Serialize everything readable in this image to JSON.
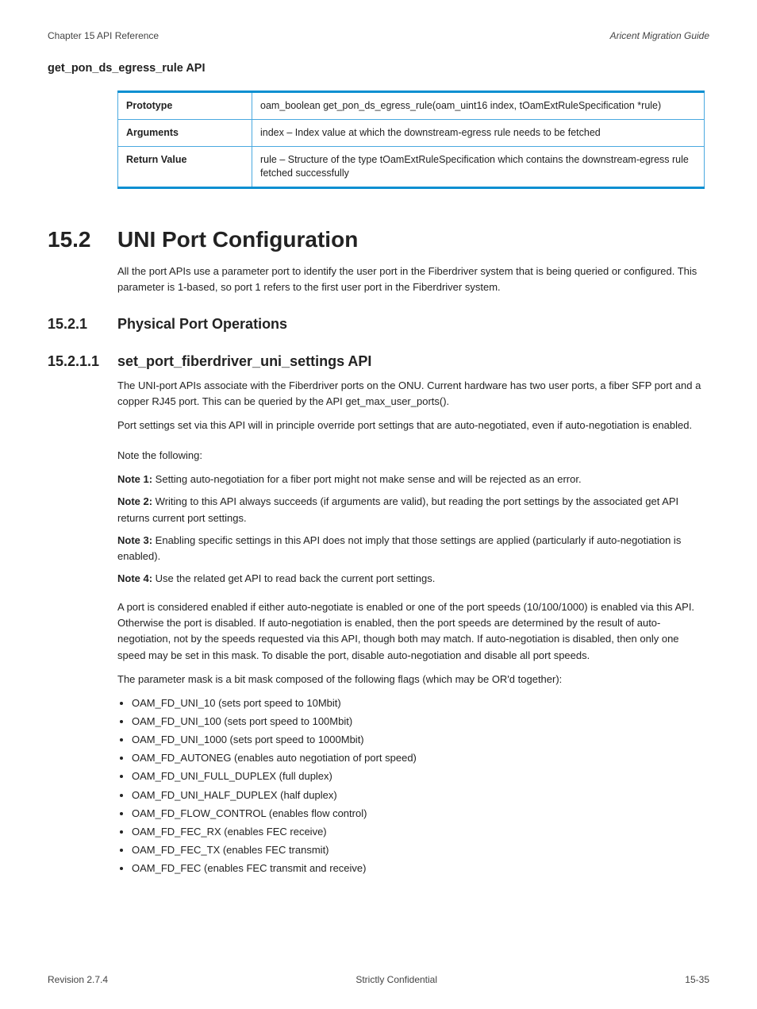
{
  "header": {
    "chapter": "Chapter 15 API Reference",
    "guide": "Aricent Migration Guide"
  },
  "doctitle": "get_pon_ds_egress_rule API",
  "table": [
    {
      "k": "Prototype",
      "v": "oam_boolean get_pon_ds_egress_rule(oam_uint16 index, tOamExtRuleSpecification *rule)"
    },
    {
      "k": "Arguments",
      "v": "index – Index value at which the downstream-egress rule needs to be fetched"
    },
    {
      "k": "Return Value",
      "v": "rule – Structure of the type tOamExtRuleSpecification which contains the downstream-egress rule fetched successfully"
    }
  ],
  "sec": {
    "n": "15.2",
    "t": "UNI Port Configuration"
  },
  "p1": "All the port APIs use a parameter port to identify the user port in the Fiberdriver system that is being queried or configured. This parameter is 1-based, so port 1 refers to the first user port in the Fiberdriver system.",
  "sub_phy": {
    "n": "15.2.1",
    "t": "Physical Port Operations"
  },
  "sub_set": {
    "n": "15.2.1.1",
    "t": "set_port_fiberdriver_uni_settings API"
  },
  "p2": "The UNI-port APIs associate with the Fiberdriver ports on the ONU. Current hardware has two user ports, a fiber SFP port and a copper RJ45 port. This can be queried by the API get_max_user_ports().",
  "p3": "Port settings set via this API will in principle override port settings that are auto-negotiated, even if auto-negotiation is enabled.",
  "note_lead": "Note the following:",
  "notes": [
    "Setting auto-negotiation for a fiber port might not make sense and will be rejected as an error.",
    "Writing to this API always succeeds (if arguments are valid), but reading the port settings by the associated get API returns current port settings.",
    "Enabling specific settings in this API does not imply that those settings are applied (particularly if auto-negotiation is enabled).",
    "Use the related get API to read back the current port settings."
  ],
  "p4": "A port is considered enabled if either auto-negotiate is enabled or one of the port speeds (10/100/1000) is enabled via this API. Otherwise the port is disabled. If auto-negotiation is enabled, then the port speeds are determined by the result of auto-negotiation, not by the speeds requested via this API, though both may match. If auto-negotiation is disabled, then only one speed may be set in this mask. To disable the port, disable auto-negotiation and disable all port speeds.",
  "p5": "The parameter mask is a bit mask composed of the following flags (which may be OR'd together):",
  "flags": [
    "OAM_FD_UNI_10 (sets port speed to 10Mbit)",
    "OAM_FD_UNI_100 (sets port speed to 100Mbit)",
    "OAM_FD_UNI_1000 (sets port speed to 1000Mbit)",
    "OAM_FD_AUTONEG (enables auto negotiation of port speed)",
    "OAM_FD_UNI_FULL_DUPLEX (full duplex)",
    "OAM_FD_UNI_HALF_DUPLEX (half duplex)",
    "OAM_FD_FLOW_CONTROL (enables flow control)",
    "OAM_FD_FEC_RX (enables FEC receive)",
    "OAM_FD_FEC_TX (enables FEC transmit)",
    "OAM_FD_FEC (enables FEC transmit and receive)"
  ],
  "footer": {
    "rev": "Revision 2.7.4",
    "conf": "Strictly Confidential",
    "page": "15-35"
  }
}
